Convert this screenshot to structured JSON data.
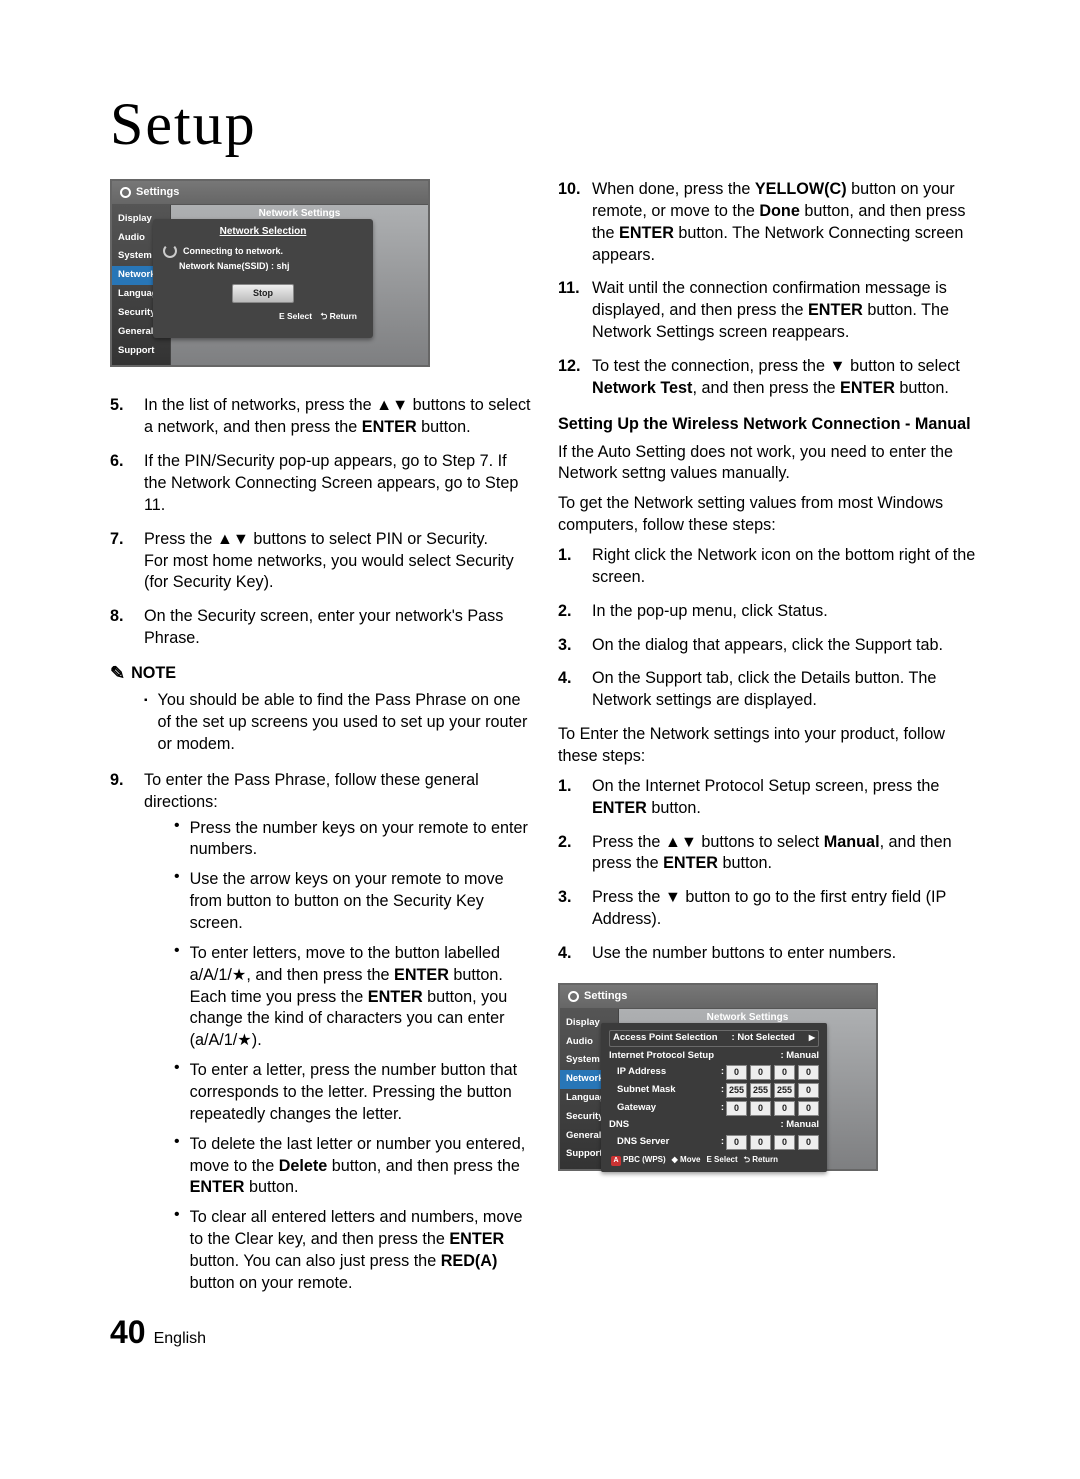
{
  "page": {
    "title": "Setup",
    "number": "40",
    "language": "English"
  },
  "shot1": {
    "bar_title": "Settings",
    "sidebar": [
      "Display",
      "Audio",
      "System",
      "Network",
      "Language",
      "Security",
      "General",
      "Support"
    ],
    "panel_title": "Network Settings",
    "popup": {
      "title": "Network Selection",
      "connecting": "Connecting to network.",
      "ssid_label": "Network Name(SSID) : shj",
      "stop": "Stop"
    },
    "footer": {
      "select": "E Select",
      "return": "⮌ Return"
    }
  },
  "shot2": {
    "bar_title": "Settings",
    "sidebar": [
      "Display",
      "Audio",
      "System",
      "Network",
      "Language",
      "Security",
      "General",
      "Support"
    ],
    "panel_title": "Network Settings",
    "panel": {
      "aps_label": "Access Point Selection",
      "aps_value": ": Not Selected",
      "ips_label": "Internet Protocol Setup",
      "ips_value": ": Manual",
      "ip_label": "IP Address",
      "ip": [
        "0",
        "0",
        "0",
        "0"
      ],
      "sm_label": "Subnet Mask",
      "sm": [
        "255",
        "255",
        "255",
        "0"
      ],
      "gw_label": "Gateway",
      "gw": [
        "0",
        "0",
        "0",
        "0"
      ],
      "dns_label": "DNS",
      "dns_value": ": Manual",
      "dnss_label": "DNS Server",
      "dnss": [
        "0",
        "0",
        "0",
        "0"
      ]
    },
    "footer": {
      "a": "A",
      "pbc": "PBC (WPS)",
      "move": "◆ Move",
      "select": "E Select",
      "return": "⮌ Return"
    }
  },
  "left": {
    "step5_pre": "In the list of networks, press the ▲▼ buttons to select a network, and then press the ",
    "enter": "ENTER",
    "step5_post": " button.",
    "step6": "If the PIN/Security pop-up appears, go to Step 7. If the Network Connecting Screen appears, go to Step 11.",
    "step7a": "Press the ▲▼ buttons to select PIN or Security.",
    "step7b": "For most home networks, you would select Security (for Security Key).",
    "step8": "On the Security screen, enter your network's Pass Phrase.",
    "note_label": "NOTE",
    "note1": "You should be able to find the Pass Phrase on one of the set up screens you used to set up your router or modem.",
    "step9lead": "To enter the Pass Phrase, follow these general directions:",
    "b1": "Press the number keys on your remote to enter numbers.",
    "b2": "Use the arrow keys on your remote to move from button to button on the Security Key screen.",
    "b3_pre": "To enter letters, move to the button labelled a/A/1/★, and then press the ",
    "b3_mid": " button. Each time you press the ",
    "b3_post": " button, you change the kind of characters you can enter (a/A/1/★).",
    "b4": "To enter a letter, press the number button that corresponds to the letter. Pressing the button repeatedly changes the letter.",
    "b5_pre": "To delete the last letter or number you entered, move to the ",
    "delete": "Delete",
    "b5_mid": " button, and then press the ",
    "b5_post": " button.",
    "b6_pre": "To clear all entered letters and numbers, move to the Clear key, and then press the ",
    "b6_mid": " button. You can also just press the ",
    "redA": "RED(A)",
    "b6_post": " button on your remote."
  },
  "right": {
    "step10_pre": "When done, press the ",
    "yellowC": "YELLOW(C)",
    "step10_mid1": " button on your remote, or move to the ",
    "done": "Done",
    "step10_mid2": " button, and then press the ",
    "step10_post": " button. The Network Connecting screen appears.",
    "step11_pre": "Wait until the connection confirmation message is displayed, and then press the ",
    "step11_post": " button. The Network Settings screen reappears.",
    "step12_pre": "To test the connection, press the ▼ button to select ",
    "nettest": "Network Test",
    "step12_mid": ", and then press the ",
    "step12_post": " button.",
    "subhead": "Setting Up the Wireless Network Connection - Manual",
    "p1": "If the Auto Setting does not work, you need to enter the Network settng values manually.",
    "p2": "To get the Network setting values from most Windows computers, follow these steps:",
    "s1": "Right click the Network icon on the bottom right of the screen.",
    "s2": "In the pop-up menu, click Status.",
    "s3": "On the dialog that appears, click the Support tab.",
    "s4": "On the Support tab, click the Details button. The Network settings are displayed.",
    "p3": "To Enter the Network settings into your product, follow these steps:",
    "t1_pre": "On the Internet Protocol Setup screen, press the ",
    "t1_post": " button.",
    "t2_pre": "Press the ▲▼ buttons to select ",
    "manual": "Manual",
    "t2_mid": ", and then press the ",
    "t2_post": " button.",
    "t3": "Press the ▼ button to go to the first entry field (IP Address).",
    "t4": "Use the number buttons to enter numbers."
  }
}
